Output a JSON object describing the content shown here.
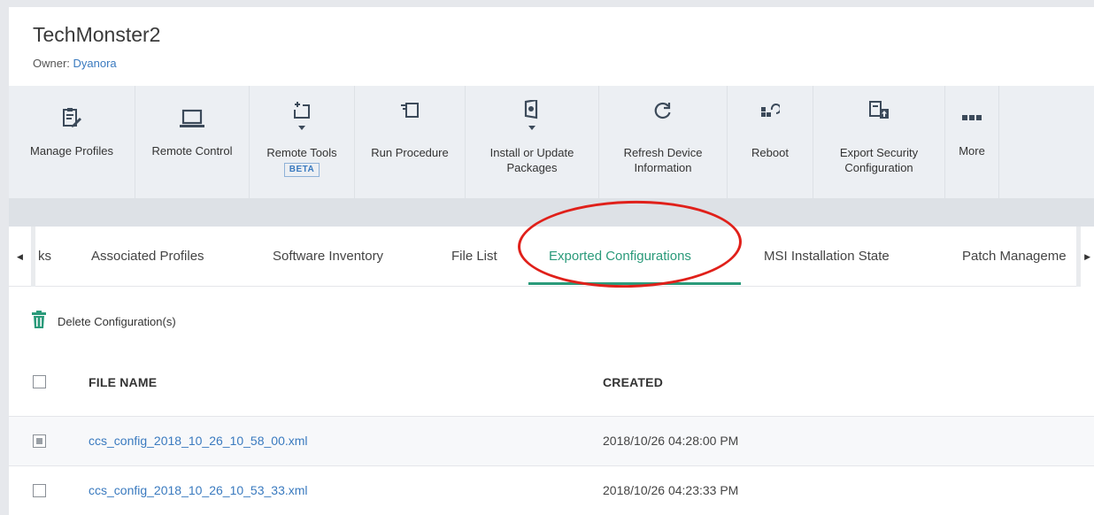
{
  "device": {
    "title": "TechMonster2",
    "owner_label": "Owner: ",
    "owner_name": "Dyanora"
  },
  "toolbar": {
    "items": [
      {
        "label": "Manage Profiles",
        "icon": "manage-profiles-icon"
      },
      {
        "label": "Remote Control",
        "icon": "laptop-icon"
      },
      {
        "label": "Remote Tools",
        "icon": "remote-tools-icon",
        "badge": "BETA",
        "has_dropdown": true
      },
      {
        "label": "Run Procedure",
        "icon": "run-procedure-icon"
      },
      {
        "label": "Install or Update\nPackages",
        "icon": "install-package-icon",
        "has_dropdown": true
      },
      {
        "label": "Refresh Device\nInformation",
        "icon": "refresh-icon"
      },
      {
        "label": "Reboot",
        "icon": "reboot-icon"
      },
      {
        "label": "Export Security\nConfiguration",
        "icon": "export-config-icon"
      },
      {
        "label": "More",
        "icon": "more-icon"
      }
    ]
  },
  "tabs": {
    "items": [
      {
        "label": "ks"
      },
      {
        "label": "Associated Profiles"
      },
      {
        "label": "Software Inventory"
      },
      {
        "label": "File List"
      },
      {
        "label": "Exported Configurations",
        "active": true
      },
      {
        "label": "MSI Installation State"
      },
      {
        "label": "Patch Manageme"
      }
    ],
    "scroll_left_icon": "chevron-left-icon",
    "scroll_right_icon": "chevron-right-icon"
  },
  "actions": {
    "delete_label": "Delete Configuration(s)",
    "delete_icon": "trash-icon"
  },
  "table": {
    "columns": [
      "FILE NAME",
      "CREATED"
    ],
    "rows": [
      {
        "file": "ccs_config_2018_10_26_10_58_00.xml",
        "created": "2018/10/26 04:28:00 PM",
        "checked": "partial"
      },
      {
        "file": "ccs_config_2018_10_26_10_53_33.xml",
        "created": "2018/10/26 04:23:33 PM",
        "checked": "none"
      }
    ]
  },
  "colors": {
    "accent_green": "#2a9a7a",
    "link_blue": "#3a7abf",
    "highlight_red": "#e0201a",
    "toolbar_bg": "#eceff3"
  }
}
